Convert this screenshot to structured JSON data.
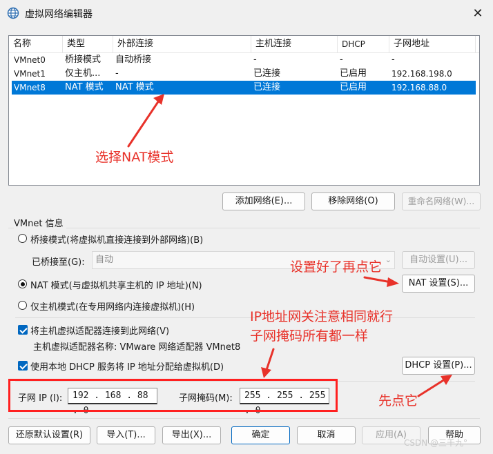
{
  "window": {
    "title": "虚拟网络编辑器",
    "close_glyph": "✕"
  },
  "table": {
    "headers": [
      "名称",
      "类型",
      "外部连接",
      "主机连接",
      "DHCP",
      "子网地址"
    ],
    "rows": [
      [
        "VMnet0",
        "桥接模式",
        "自动桥接",
        "-",
        "-",
        "-"
      ],
      [
        "VMnet1",
        "仅主机...",
        "-",
        "已连接",
        "已启用",
        "192.168.198.0"
      ],
      [
        "VMnet8",
        "NAT 模式",
        "NAT 模式",
        "已连接",
        "已启用",
        "192.168.88.0"
      ]
    ],
    "selected_row": 2
  },
  "buttons": {
    "add_network": "添加网络(E)...",
    "remove_network": "移除网络(O)",
    "rename_network": "重命名网络(W)...",
    "auto_settings": "自动设置(U)...",
    "nat_settings": "NAT 设置(S)...",
    "dhcp_settings": "DHCP 设置(P)...",
    "restore_defaults": "还原默认设置(R)",
    "import": "导入(T)...",
    "export": "导出(X)...",
    "ok": "确定",
    "cancel": "取消",
    "apply": "应用(A)",
    "help": "帮助"
  },
  "vmnet_info": {
    "group_label": "VMnet 信息",
    "bridged_option": "桥接模式(将虚拟机直接连接到外部网络)(B)",
    "bridged_to_label": "已桥接至(G):",
    "bridged_to_value": "自动",
    "nat_option": "NAT 模式(与虚拟机共享主机的 IP 地址)(N)",
    "host_only_option": "仅主机模式(在专用网络内连接虚拟机)(H)",
    "selected_mode": "nat",
    "connect_adapter_label": "将主机虚拟适配器连接到此网络(V)",
    "connect_adapter_checked": true,
    "adapter_name_label": "主机虚拟适配器名称: VMware 网络适配器 VMnet8",
    "use_dhcp_label": "使用本地 DHCP 服务将 IP 地址分配给虚拟机(D)",
    "use_dhcp_checked": true,
    "subnet_ip_label": "子网 IP (I):",
    "subnet_ip_value": "192 . 168 . 88 . 0",
    "subnet_mask_label": "子网掩码(M):",
    "subnet_mask_value": "255 . 255 . 255 . 0"
  },
  "annotations": {
    "select_nat": "选择NAT模式",
    "click_after_setup": "设置好了再点它",
    "gateway_note_1": "IP地址网关注意相同就行",
    "gateway_note_2": "子网掩码所有都一样",
    "click_first": "先点它"
  },
  "watermark": "CSDN @三千九°",
  "colors": {
    "selection": "#0078d7",
    "annotation": "#e8322a",
    "accent": "#0067c0"
  }
}
